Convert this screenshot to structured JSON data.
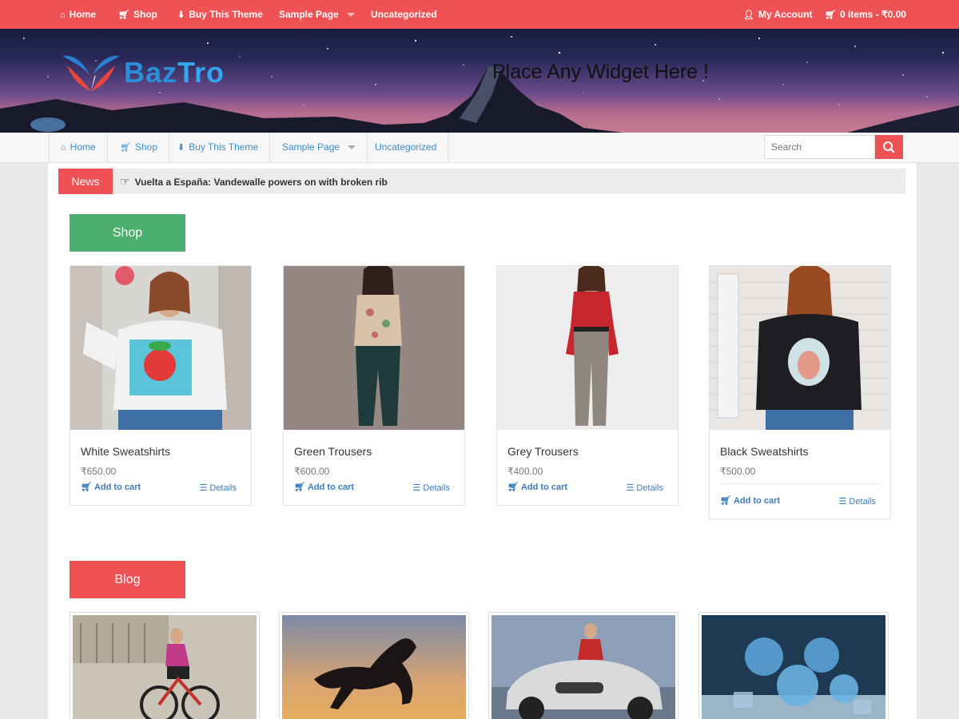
{
  "topbar": {
    "nav": [
      {
        "icon": "home-icon",
        "label": "Home"
      },
      {
        "icon": "cart-icon",
        "label": "Shop"
      },
      {
        "icon": "download-icon",
        "label": "Buy This Theme"
      },
      {
        "icon": "chevron-down-icon",
        "label": "Sample Page"
      },
      {
        "icon": "",
        "label": "Uncategorized"
      }
    ],
    "account_label": "My Account",
    "cart_label": "0 items - ₹0.00"
  },
  "header": {
    "logo_part1": "Baz",
    "logo_part2": "Tro",
    "widget_text": "Place Any Widget Here !"
  },
  "navbar": {
    "items": [
      {
        "icon": "home-icon",
        "label": "Home"
      },
      {
        "icon": "cart-icon",
        "label": "Shop"
      },
      {
        "icon": "download-icon",
        "label": "Buy This Theme"
      },
      {
        "icon": "chevron-down-icon",
        "label": "Sample Page"
      },
      {
        "icon": "",
        "label": "Uncategorized"
      }
    ],
    "search_placeholder": "Search"
  },
  "news": {
    "label": "News",
    "headline": "Vuelta a España: Vandewalle powers on with broken rib"
  },
  "shop": {
    "title": "Shop",
    "products": [
      {
        "name": "White Sweatshirts",
        "price": "₹650.00",
        "cart": "Add to cart",
        "details": "Details"
      },
      {
        "name": "Green Trousers",
        "price": "₹600.00",
        "cart": "Add to cart",
        "details": "Details"
      },
      {
        "name": "Grey Trousers",
        "price": "₹400.00",
        "cart": "Add to cart",
        "details": "Details"
      },
      {
        "name": "Black Sweatshirts",
        "price": "₹500.00",
        "cart": "Add to cart",
        "details": "Details"
      }
    ]
  },
  "blog": {
    "title": "Blog"
  },
  "colors": {
    "accent": "#ee5254",
    "shop_green": "#4caf6e",
    "link_blue": "#3a7cc0"
  }
}
